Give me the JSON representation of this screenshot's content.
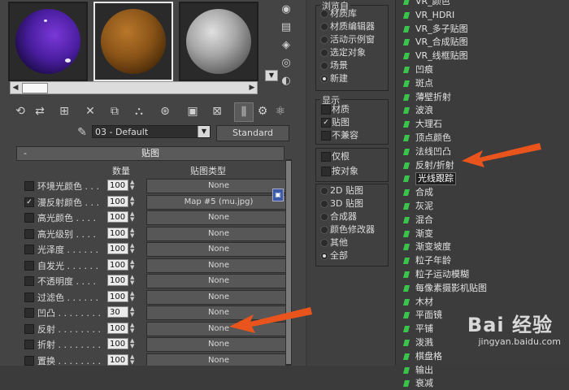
{
  "material_editor": {
    "slots": [
      {
        "name": "purple"
      },
      {
        "name": "wood"
      },
      {
        "name": "gray"
      }
    ],
    "material_name": "03 - Default",
    "material_type_button": "Standard",
    "rollout_title": "贴图",
    "rollout_collapse": "-",
    "header_amount": "数量",
    "header_map_type": "贴图类型",
    "rows": [
      {
        "label": "环境光颜色 . . .",
        "checked": false,
        "amount": "100",
        "map": "None"
      },
      {
        "label": "漫反射颜色 . . .",
        "checked": true,
        "amount": "100",
        "map": "Map #5 (mu.jpg)"
      },
      {
        "label": "高光颜色 . . . .",
        "checked": false,
        "amount": "100",
        "map": "None"
      },
      {
        "label": "高光级别 . . . .",
        "checked": false,
        "amount": "100",
        "map": "None"
      },
      {
        "label": "光泽度 . . . . . .",
        "checked": false,
        "amount": "100",
        "map": "None"
      },
      {
        "label": "自发光 . . . . . .",
        "checked": false,
        "amount": "100",
        "map": "None"
      },
      {
        "label": "不透明度 . . . .",
        "checked": false,
        "amount": "100",
        "map": "None"
      },
      {
        "label": "过滤色 . . . . . .",
        "checked": false,
        "amount": "100",
        "map": "None"
      },
      {
        "label": "凹凸 . . . . . . . .",
        "checked": false,
        "amount": "30",
        "map": "None"
      },
      {
        "label": "反射 . . . . . . . .",
        "checked": false,
        "amount": "100",
        "map": "None"
      },
      {
        "label": "折射 . . . . . . . .",
        "checked": false,
        "amount": "100",
        "map": "None"
      },
      {
        "label": "置换 . . . . . . . .",
        "checked": false,
        "amount": "100",
        "map": "None"
      }
    ]
  },
  "browser": {
    "browse_from_title": "浏览自",
    "browse_from": [
      {
        "label": "材质库",
        "on": false
      },
      {
        "label": "材质编辑器",
        "on": false
      },
      {
        "label": "活动示例窗",
        "on": false
      },
      {
        "label": "选定对象",
        "on": false
      },
      {
        "label": "场景",
        "on": false
      },
      {
        "label": "新建",
        "on": true
      }
    ],
    "show_title": "显示",
    "show": [
      {
        "label": "材质",
        "checked": false
      },
      {
        "label": "贴图",
        "checked": true
      },
      {
        "label": "不兼容",
        "checked": false
      }
    ],
    "filter": [
      {
        "label": "仅根",
        "checked": false
      },
      {
        "label": "按对象",
        "checked": false
      }
    ],
    "map_types": [
      {
        "label": "2D 贴图",
        "on": false
      },
      {
        "label": "3D 贴图",
        "on": false
      },
      {
        "label": "合成器",
        "on": false
      },
      {
        "label": "颜色修改器",
        "on": false
      },
      {
        "label": "其他",
        "on": false
      },
      {
        "label": "全部",
        "on": true
      }
    ]
  },
  "map_list": [
    "VR_颜色",
    "VR_HDRI",
    "VR_多子贴图",
    "VR_合成贴图",
    "VR_线框贴图",
    "凹痕",
    "斑点",
    "薄壁折射",
    "波浪",
    "大理石",
    "顶点颜色",
    "法线凹凸",
    "反射/折射",
    "光线跟踪",
    "合成",
    "灰泥",
    "混合",
    "渐变",
    "渐变坡度",
    "粒子年龄",
    "粒子运动模糊",
    "每像素摄影机贴图",
    "木材",
    "平面镜",
    "平铺",
    "泼溅",
    "棋盘格",
    "输出",
    "衰减"
  ],
  "selected_map": "光线跟踪",
  "watermark": {
    "brand": "Bai 经验",
    "url": "jingyan.baidu.com"
  }
}
